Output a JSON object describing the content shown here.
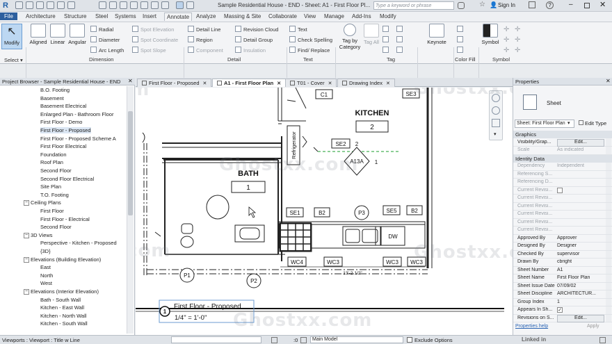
{
  "titlebar": {
    "title": "Sample Residential House - END - Sheet: A1 - First Floor Pl...",
    "search_placeholder": "Type a keyword or phrase",
    "sign_in": "Sign In"
  },
  "menu": [
    "File",
    "Architecture",
    "Structure",
    "Steel",
    "Systems",
    "Insert",
    "Annotate",
    "Analyze",
    "Massing & Site",
    "Collaborate",
    "View",
    "Manage",
    "Add-Ins",
    "Modify"
  ],
  "active_menu": "Annotate",
  "ribbon": {
    "modify": "Modify",
    "select": "Select",
    "select_arrow": "▾",
    "dimension_tools": [
      "Aligned",
      "Linear",
      "Angular"
    ],
    "dimension_small": [
      "Radial",
      "Diameter",
      "Arc Length"
    ],
    "spot_small": [
      "Spot Elevation",
      "Spot Coordinate",
      "Spot Slope"
    ],
    "dimension_label": "Dimension",
    "detail_small_1": [
      "Detail Line",
      "Region",
      "Component"
    ],
    "detail_small_2": [
      "Revision Cloud",
      "Detail Group",
      "Insulation"
    ],
    "detail_label": "Detail",
    "text_small": [
      "Text",
      "Check Spelling",
      "Find/ Replace"
    ],
    "text_label": "Text",
    "tag_tools": [
      "Tag by Category",
      "Tag All"
    ],
    "tag_label": "Tag",
    "keynote": "Keynote",
    "color_fill_label": "Color Fill",
    "symbol": "Symbol",
    "symbol_label": "Symbol"
  },
  "project_browser": {
    "title": "Project Browser - Sample Residential House - END",
    "items": [
      {
        "label": "B.O. Footing",
        "indent": 2
      },
      {
        "label": "Basement",
        "indent": 2
      },
      {
        "label": "Basement Electrical",
        "indent": 2
      },
      {
        "label": "Enlarged Plan - Bathroom Floor",
        "indent": 2
      },
      {
        "label": "First Floor - Demo",
        "indent": 2
      },
      {
        "label": "First Floor - Proposed",
        "indent": 2,
        "selected": true
      },
      {
        "label": "First Floor - Proposed Scheme A",
        "indent": 2
      },
      {
        "label": "First Floor Electrical",
        "indent": 2
      },
      {
        "label": "Foundation",
        "indent": 2
      },
      {
        "label": "Roof Plan",
        "indent": 2
      },
      {
        "label": "Second Floor",
        "indent": 2
      },
      {
        "label": "Second Floor Electrical",
        "indent": 2
      },
      {
        "label": "Site Plan",
        "indent": 2
      },
      {
        "label": "T.O. Footing",
        "indent": 2
      },
      {
        "label": "Ceiling Plans",
        "indent": 1,
        "expander": "−"
      },
      {
        "label": "First Floor",
        "indent": 2
      },
      {
        "label": "First Floor - Electrical",
        "indent": 2
      },
      {
        "label": "Second Floor",
        "indent": 2
      },
      {
        "label": "3D Views",
        "indent": 1,
        "expander": "−"
      },
      {
        "label": "Perspective - Kitchen - Proposed",
        "indent": 2
      },
      {
        "label": "{3D}",
        "indent": 2
      },
      {
        "label": "Elevations (Building Elevation)",
        "indent": 1,
        "expander": "−"
      },
      {
        "label": "East",
        "indent": 2
      },
      {
        "label": "North",
        "indent": 2
      },
      {
        "label": "West",
        "indent": 2
      },
      {
        "label": "Elevations (Interior Elevation)",
        "indent": 1,
        "expander": "−"
      },
      {
        "label": "Bath - South Wall",
        "indent": 2
      },
      {
        "label": "Kitchen - East Wall",
        "indent": 2
      },
      {
        "label": "Kitchen - North Wall",
        "indent": 2
      },
      {
        "label": "Kitchen - South Wall",
        "indent": 2
      }
    ]
  },
  "tabs": [
    {
      "label": "First Floor - Proposed",
      "active": false
    },
    {
      "label": "A1 - First Floor Plan",
      "active": true
    },
    {
      "label": "T01 - Cover",
      "active": false
    },
    {
      "label": "Drawing Index",
      "active": false
    }
  ],
  "drawing": {
    "kitchen_label": "KITCHEN",
    "kitchen_number": "2",
    "bath_label": "BATH",
    "bath_number": "1",
    "refrigerator": "Refrigerator",
    "door_tag": "A13A",
    "door_tag_num": "1",
    "tag_se2_num": "2",
    "tags": [
      "C1",
      "SE3",
      "SE2",
      "SE1",
      "B2",
      "P3",
      "SE5",
      "B2",
      "WC4",
      "WC3",
      "WC3",
      "WC3",
      "P1",
      "P2"
    ],
    "dishwasher": "DW",
    "dimension": "13'-2 1/2\"",
    "view_title": "First Floor - Proposed",
    "view_number": "1",
    "view_scale": "1/4\" = 1'-0\""
  },
  "properties": {
    "title": "Properties",
    "type_name": "Sheet",
    "selector": "Sheet: First Floor Plan",
    "edit_type": "Edit Type",
    "groups": [
      {
        "name": "Graphics",
        "rows": [
          {
            "k": "Visibility/Grap...",
            "v": "Edit...",
            "button": true
          },
          {
            "k": "Scale",
            "v": "As indicated",
            "dim": true
          }
        ]
      },
      {
        "name": "Identity Data",
        "rows": [
          {
            "k": "Dependency",
            "v": "Independent",
            "dim": true
          },
          {
            "k": "Referencing S...",
            "v": "",
            "dim": true
          },
          {
            "k": "Referencing D...",
            "v": "",
            "dim": true
          },
          {
            "k": "Current Revisi...",
            "v": "",
            "dim": true,
            "check": true
          },
          {
            "k": "Current Revisi...",
            "v": "",
            "dim": true
          },
          {
            "k": "Current Revisi...",
            "v": "",
            "dim": true
          },
          {
            "k": "Current Revisi...",
            "v": "",
            "dim": true
          },
          {
            "k": "Current Revisi...",
            "v": "",
            "dim": true
          },
          {
            "k": "Current Revisi...",
            "v": "",
            "dim": true
          },
          {
            "k": "Approved By",
            "v": "Approver"
          },
          {
            "k": "Designed By",
            "v": "Designer"
          },
          {
            "k": "Checked By",
            "v": "supervisor"
          },
          {
            "k": "Drawn By",
            "v": "cbright"
          },
          {
            "k": "Sheet Number",
            "v": "A1"
          },
          {
            "k": "Sheet Name",
            "v": "First Floor Plan"
          },
          {
            "k": "Sheet Issue Date",
            "v": "07/09/02"
          },
          {
            "k": "Sheet Discipline",
            "v": "ARCHITECTUR..."
          },
          {
            "k": "Group Index",
            "v": "1"
          },
          {
            "k": "Appears In Sh...",
            "v": "",
            "check": true,
            "checked": true
          },
          {
            "k": "Revisions on S...",
            "v": "Edit...",
            "button": true
          }
        ]
      }
    ],
    "help": "Properties help",
    "apply": "Apply"
  },
  "statusbar": {
    "text": "Viewports : Viewport : Title w Line",
    "coord": ":0",
    "model": "Main Model",
    "exclude": "Exclude Options"
  },
  "watermark": "Ghostxx.com",
  "linkedin": "Linked in"
}
